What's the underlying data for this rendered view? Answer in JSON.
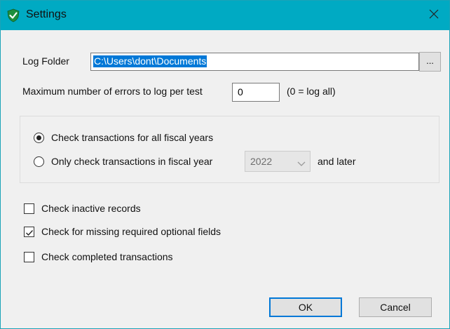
{
  "window": {
    "title": "Settings",
    "app_icon": "shield-check-icon",
    "close_icon": "close-icon",
    "accent_color": "#00aac3"
  },
  "log_folder": {
    "label": "Log Folder",
    "value": "C:\\Users\\dont\\Documents",
    "browse_label": "..."
  },
  "max_errors": {
    "label": "Maximum number of errors to log per test",
    "value": "0",
    "hint": "(0 = log all)"
  },
  "fiscal": {
    "option_all": "Check transactions for all fiscal years",
    "option_only": "Only check transactions in fiscal year",
    "selected_option": "all",
    "year": "2022",
    "year_disabled": true,
    "suffix": "and later"
  },
  "options": [
    {
      "label": "Check inactive records",
      "checked": false
    },
    {
      "label": "Check for missing required optional fields",
      "checked": true
    },
    {
      "label": "Check completed transactions",
      "checked": false
    }
  ],
  "buttons": {
    "ok": "OK",
    "cancel": "Cancel"
  }
}
